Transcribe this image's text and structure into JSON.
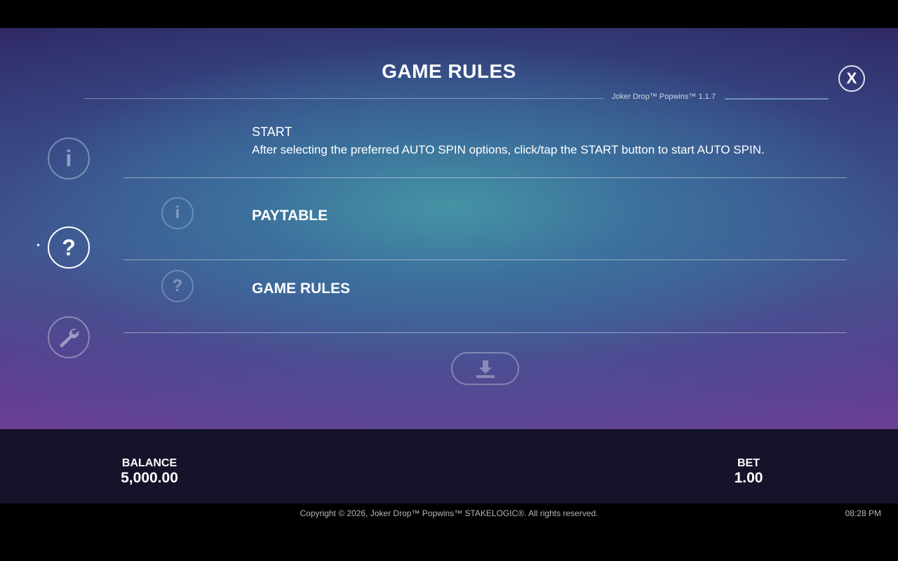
{
  "header": {
    "title": "GAME RULES",
    "close_label": "X",
    "version": "Joker Drop™ Popwins™ 1.1.7"
  },
  "sidebar": {
    "items": [
      {
        "icon": "info-icon",
        "glyph": "i",
        "active": false
      },
      {
        "icon": "question-icon",
        "glyph": "?",
        "active": true
      },
      {
        "icon": "wrench-icon",
        "active": false
      }
    ]
  },
  "content": {
    "start_label": "START",
    "start_description": "After selecting the preferred AUTO SPIN options, click/tap the START button to start AUTO SPIN.",
    "links": [
      {
        "label": "PAYTABLE",
        "icon": "info-icon",
        "glyph": "i"
      },
      {
        "label": "GAME RULES",
        "icon": "question-icon",
        "glyph": "?"
      }
    ],
    "download_icon": "download-icon"
  },
  "status": {
    "balance_label": "BALANCE",
    "balance_value": "5,000.00",
    "bet_label": "BET",
    "bet_value": "1.00"
  },
  "footer": {
    "copyright": "Copyright © 2026, Joker Drop™ Popwins™ STAKELOGIC®. All rights reserved.",
    "time": "08:28 PM"
  }
}
